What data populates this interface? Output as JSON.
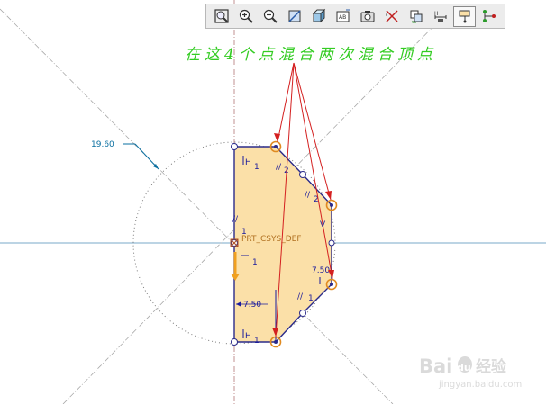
{
  "toolbar": {
    "buttons": [
      {
        "icon": "refit-icon"
      },
      {
        "icon": "zoom-in-icon"
      },
      {
        "icon": "zoom-out-icon"
      },
      {
        "icon": "repaint-icon"
      },
      {
        "icon": "shading-icon"
      },
      {
        "icon": "orient-icon"
      },
      {
        "icon": "saved-view-icon"
      },
      {
        "icon": "display-constraints-icon"
      },
      {
        "icon": "display-vertices-icon"
      },
      {
        "icon": "display-dimensions-icon"
      },
      {
        "icon": "sketch-settings-icon",
        "active": true
      },
      {
        "icon": "display-points-icon"
      }
    ]
  },
  "annotation": {
    "text": "在这4个点混合两次混合顶点",
    "color": "#33cc22",
    "arrow_color": "#d42020"
  },
  "sketch": {
    "csys_label": "PRT_CSYS_DEF",
    "dimensions": {
      "radius": "19.60",
      "left_width": "7.50",
      "right_width": "7.50"
    },
    "constraints": {
      "h_top": "H",
      "h_top_index": "1",
      "h_bottom": "H",
      "h_bottom_index": "1",
      "parallel_top_left": "//",
      "parallel_mid_left": "//",
      "parallel_right_upper": "//",
      "parallel_right_lower": "//",
      "parallel_index_1": "1",
      "parallel_index_2": "2",
      "perp_origin": "1",
      "perp_origin_index": "1",
      "v_right": "V"
    },
    "colors": {
      "fill": "#fbe0a8",
      "outline": "#2b2b8a",
      "construction": "#9a9a9a",
      "axis_horizontal": "#7aa8c8",
      "axis_vertical": "#c09090",
      "dimension_blue": "#0a6fa0",
      "vertex_highlight": "#e08a20"
    }
  },
  "watermark": {
    "brand": "Bai",
    "brand2": "du",
    "brand_cn": "经验",
    "url": "jingyan.baidu.com"
  }
}
